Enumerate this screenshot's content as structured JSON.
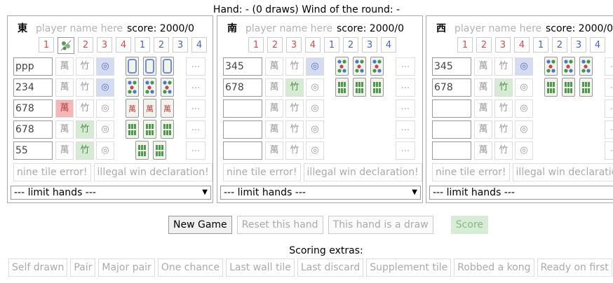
{
  "hand_info": {
    "hand_label": "Hand:",
    "hand_value": "-",
    "draws": "(0 draws)",
    "wind_label": "Wind of the round:",
    "wind_value": "-"
  },
  "tile_buttons": [
    "1",
    "2",
    "3",
    "4",
    "1",
    "2",
    "3",
    "4"
  ],
  "players": [
    {
      "wind": "東",
      "name_placeholder": "player name here",
      "score_label": "score:",
      "score": "2000/0",
      "has_flower": true,
      "rows": [
        {
          "set": "ppp",
          "active": "dot",
          "tiles": [
            "c",
            "c",
            "c"
          ]
        },
        {
          "set": "234",
          "active": "dot",
          "tiles": [
            "d",
            "d",
            "d"
          ]
        },
        {
          "set": "678",
          "active": "wan",
          "tiles": [
            "w",
            "w",
            "w"
          ]
        },
        {
          "set": "678",
          "active": "bam",
          "tiles": [
            "b",
            "b",
            "b"
          ]
        },
        {
          "set": "55",
          "active": "bam",
          "tiles": [
            "b",
            "b"
          ]
        }
      ]
    },
    {
      "wind": "南",
      "name_placeholder": "player name here",
      "score_label": "score:",
      "score": "2000/0",
      "has_flower": false,
      "rows": [
        {
          "set": "345",
          "active": "dot",
          "tiles": [
            "d",
            "d",
            "d"
          ]
        },
        {
          "set": "678",
          "active": "bam",
          "tiles": [
            "b",
            "b",
            "b"
          ]
        },
        {
          "set": "",
          "active": "",
          "tiles": []
        },
        {
          "set": "",
          "active": "",
          "tiles": []
        },
        {
          "set": "",
          "active": "",
          "tiles": []
        }
      ]
    },
    {
      "wind": "西",
      "name_placeholder": "player name here",
      "score_label": "score:",
      "score": "2000/0",
      "has_flower": false,
      "rows": [
        {
          "set": "345",
          "active": "dot",
          "tiles": [
            "d",
            "d",
            "d"
          ]
        },
        {
          "set": "678",
          "active": "bam",
          "tiles": [
            "b",
            "b",
            "b"
          ]
        },
        {
          "set": "",
          "active": "",
          "tiles": []
        },
        {
          "set": "",
          "active": "",
          "tiles": []
        },
        {
          "set": "",
          "active": "",
          "tiles": []
        }
      ]
    }
  ],
  "suit_labels": {
    "wan": "萬",
    "bam": "竹",
    "dot": "◎",
    "more": "..."
  },
  "error_buttons": {
    "nine_tile": "nine tile error!",
    "illegal_win": "illegal win declaration!"
  },
  "limit_select": "--- limit hands ---",
  "controls": {
    "new_game": "New Game",
    "reset": "Reset this hand",
    "draw": "This hand is a draw",
    "score": "Score"
  },
  "extras_label": "Scoring extras:",
  "extras": [
    "Self drawn",
    "Pair",
    "Major pair",
    "One chance",
    "Last wall tile",
    "Last discard",
    "Supplement tile",
    "Robbed a kong",
    "Ready on first"
  ],
  "colors": {
    "red": "#d94b4b",
    "blue": "#4a62c8",
    "wan_active": "#f4b6b6",
    "bam_active": "#d5ecd3",
    "dot_active": "#d4dcf3",
    "score_btn": "#d7ecd5"
  }
}
